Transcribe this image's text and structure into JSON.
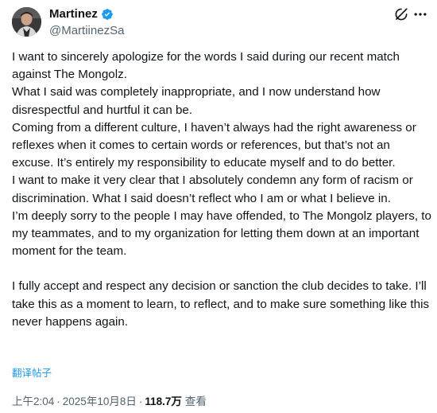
{
  "author": {
    "name": "Martinez",
    "handle": "@MartiinezSa"
  },
  "icons": {
    "verified": "verified-badge-icon",
    "grok": "grok-icon",
    "more": "more-options-icon"
  },
  "colors": {
    "verified": "#1d9bf0",
    "link": "#1d9bf0",
    "secondary_text": "#536471"
  },
  "post": {
    "paragraphs": [
      "I want to sincerely apologize for the words I said during our recent match against The Mongolz.",
      "What I said was completely inappropriate, and I now understand how disrespectful and hurtful it can be.",
      "Coming from a different culture, I haven’t always had the right awareness or reflexes when it comes to certain words or references, but that’s not an excuse. It’s entirely my responsibility to educate myself and to do better.",
      "I want to make it very clear that I absolutely condemn any form of racism or discrimination. What I said doesn’t reflect who I am or what I believe in.",
      "I’m deeply sorry to the people I may have offended, to The Mongolz players, to my teammates, and to my organization for letting them down at an important moment for the team.",
      "I fully accept and respect any decision or sanction the club decides to take. I’ll take this as a moment to learn, to reflect, and to make sure something like this never happens again."
    ],
    "translate_label": "翻译帖子",
    "time": "上午2:04",
    "date": "2025年10月8日",
    "views_count": "118.7万",
    "views_label": "查看",
    "separator": "·"
  }
}
